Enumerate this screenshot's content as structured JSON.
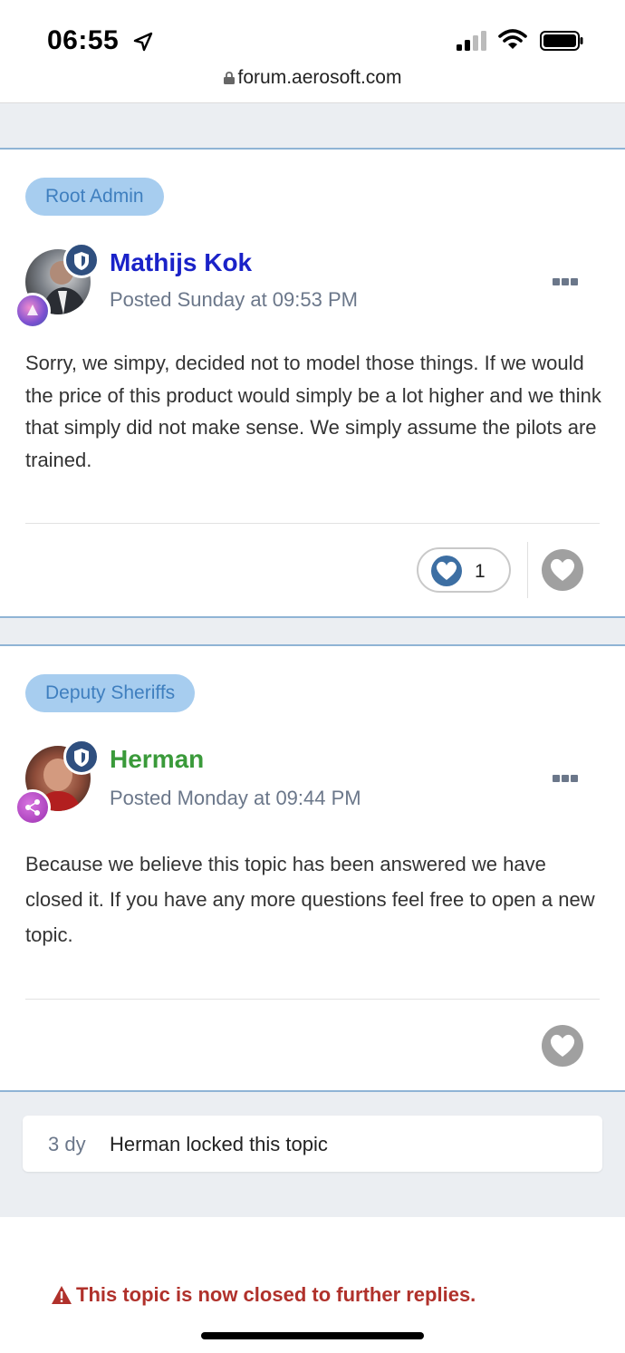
{
  "status_bar": {
    "time": "06:55",
    "url": "forum.aerosoft.com"
  },
  "posts": [
    {
      "role": "Root Admin",
      "author": "Mathijs Kok",
      "author_color": "#1a22c8",
      "posted": "Posted Sunday at 09:53 PM",
      "body": "Sorry, we simpy, decided not to model those things. If we would the price of this product would simply be a lot higher and we think that simply did not make sense. We simply assume the pilots are trained.",
      "reaction_count": "1"
    },
    {
      "role": "Deputy Sheriffs",
      "author": "Herman",
      "author_color": "#3a9a3a",
      "posted": "Posted Monday at 09:44 PM",
      "body": "Because we believe this topic has been answered we have closed it. If you have any more questions feel free to open a new topic."
    }
  ],
  "activity": {
    "time": "3 dy",
    "text": "Herman locked this topic"
  },
  "closed_notice": "This topic is now closed to further replies.",
  "icons": [
    "location-arrow-icon",
    "signal-icon",
    "wifi-icon",
    "battery-icon",
    "lock-icon",
    "shield-icon",
    "more-icon",
    "heart-icon",
    "warning-icon"
  ]
}
